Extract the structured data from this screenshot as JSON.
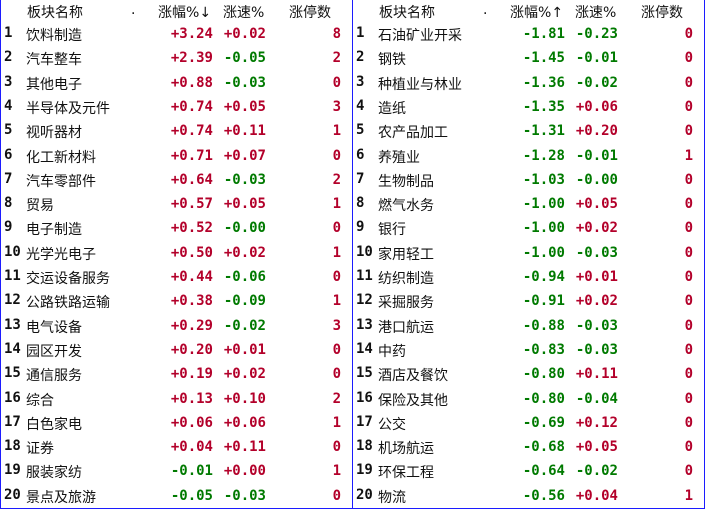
{
  "headers": {
    "name": "板块名称",
    "dot": ".",
    "pct": "涨幅%",
    "spd": "涨速%",
    "stop": "涨停数",
    "pct_sort_left": "↓",
    "pct_sort_right": "↑"
  },
  "left": [
    {
      "idx": "1",
      "name": "饮料制造",
      "pct": "+3.24",
      "spd": "+0.02",
      "stop": "8"
    },
    {
      "idx": "2",
      "name": "汽车整车",
      "pct": "+2.39",
      "spd": "-0.05",
      "stop": "2"
    },
    {
      "idx": "3",
      "name": "其他电子",
      "pct": "+0.88",
      "spd": "-0.03",
      "stop": "0"
    },
    {
      "idx": "4",
      "name": "半导体及元件",
      "pct": "+0.74",
      "spd": "+0.05",
      "stop": "3"
    },
    {
      "idx": "5",
      "name": "视听器材",
      "pct": "+0.74",
      "spd": "+0.11",
      "stop": "1"
    },
    {
      "idx": "6",
      "name": "化工新材料",
      "pct": "+0.71",
      "spd": "+0.07",
      "stop": "0"
    },
    {
      "idx": "7",
      "name": "汽车零部件",
      "pct": "+0.64",
      "spd": "-0.03",
      "stop": "2"
    },
    {
      "idx": "8",
      "name": "贸易",
      "pct": "+0.57",
      "spd": "+0.05",
      "stop": "1"
    },
    {
      "idx": "9",
      "name": "电子制造",
      "pct": "+0.52",
      "spd": "-0.00",
      "stop": "0"
    },
    {
      "idx": "10",
      "name": "光学光电子",
      "pct": "+0.50",
      "spd": "+0.02",
      "stop": "1"
    },
    {
      "idx": "11",
      "name": "交运设备服务",
      "pct": "+0.44",
      "spd": "-0.06",
      "stop": "0"
    },
    {
      "idx": "12",
      "name": "公路铁路运输",
      "pct": "+0.38",
      "spd": "-0.09",
      "stop": "1"
    },
    {
      "idx": "13",
      "name": "电气设备",
      "pct": "+0.29",
      "spd": "-0.02",
      "stop": "3"
    },
    {
      "idx": "14",
      "name": "园区开发",
      "pct": "+0.20",
      "spd": "+0.01",
      "stop": "0"
    },
    {
      "idx": "15",
      "name": "通信服务",
      "pct": "+0.19",
      "spd": "+0.02",
      "stop": "0"
    },
    {
      "idx": "16",
      "name": "综合",
      "pct": "+0.13",
      "spd": "+0.10",
      "stop": "2"
    },
    {
      "idx": "17",
      "name": "白色家电",
      "pct": "+0.06",
      "spd": "+0.06",
      "stop": "1"
    },
    {
      "idx": "18",
      "name": "证券",
      "pct": "+0.04",
      "spd": "+0.11",
      "stop": "0"
    },
    {
      "idx": "19",
      "name": "服装家纺",
      "pct": "-0.01",
      "spd": "+0.00",
      "stop": "1"
    },
    {
      "idx": "20",
      "name": "景点及旅游",
      "pct": "-0.05",
      "spd": "-0.03",
      "stop": "0"
    }
  ],
  "right": [
    {
      "idx": "1",
      "name": "石油矿业开采",
      "pct": "-1.81",
      "spd": "-0.23",
      "stop": "0"
    },
    {
      "idx": "2",
      "name": "钢铁",
      "pct": "-1.45",
      "spd": "-0.01",
      "stop": "0"
    },
    {
      "idx": "3",
      "name": "种植业与林业",
      "pct": "-1.36",
      "spd": "-0.02",
      "stop": "0"
    },
    {
      "idx": "4",
      "name": "造纸",
      "pct": "-1.35",
      "spd": "+0.06",
      "stop": "0"
    },
    {
      "idx": "5",
      "name": "农产品加工",
      "pct": "-1.31",
      "spd": "+0.20",
      "stop": "0"
    },
    {
      "idx": "6",
      "name": "养殖业",
      "pct": "-1.28",
      "spd": "-0.01",
      "stop": "1"
    },
    {
      "idx": "7",
      "name": "生物制品",
      "pct": "-1.03",
      "spd": "-0.00",
      "stop": "0"
    },
    {
      "idx": "8",
      "name": "燃气水务",
      "pct": "-1.00",
      "spd": "+0.05",
      "stop": "0"
    },
    {
      "idx": "9",
      "name": "银行",
      "pct": "-1.00",
      "spd": "+0.02",
      "stop": "0"
    },
    {
      "idx": "10",
      "name": "家用轻工",
      "pct": "-1.00",
      "spd": "-0.03",
      "stop": "0"
    },
    {
      "idx": "11",
      "name": "纺织制造",
      "pct": "-0.94",
      "spd": "+0.01",
      "stop": "0"
    },
    {
      "idx": "12",
      "name": "采掘服务",
      "pct": "-0.91",
      "spd": "+0.02",
      "stop": "0"
    },
    {
      "idx": "13",
      "name": "港口航运",
      "pct": "-0.88",
      "spd": "-0.03",
      "stop": "0"
    },
    {
      "idx": "14",
      "name": "中药",
      "pct": "-0.83",
      "spd": "-0.03",
      "stop": "0"
    },
    {
      "idx": "15",
      "name": "酒店及餐饮",
      "pct": "-0.80",
      "spd": "+0.11",
      "stop": "0"
    },
    {
      "idx": "16",
      "name": "保险及其他",
      "pct": "-0.80",
      "spd": "-0.04",
      "stop": "0"
    },
    {
      "idx": "17",
      "name": "公交",
      "pct": "-0.69",
      "spd": "+0.12",
      "stop": "0"
    },
    {
      "idx": "18",
      "name": "机场航运",
      "pct": "-0.68",
      "spd": "+0.05",
      "stop": "0"
    },
    {
      "idx": "19",
      "name": "环保工程",
      "pct": "-0.64",
      "spd": "-0.02",
      "stop": "0"
    },
    {
      "idx": "20",
      "name": "物流",
      "pct": "-0.56",
      "spd": "+0.04",
      "stop": "1"
    }
  ],
  "colors": {
    "up": "#b3002a",
    "down": "#007a00",
    "border": "#1c1cff"
  }
}
